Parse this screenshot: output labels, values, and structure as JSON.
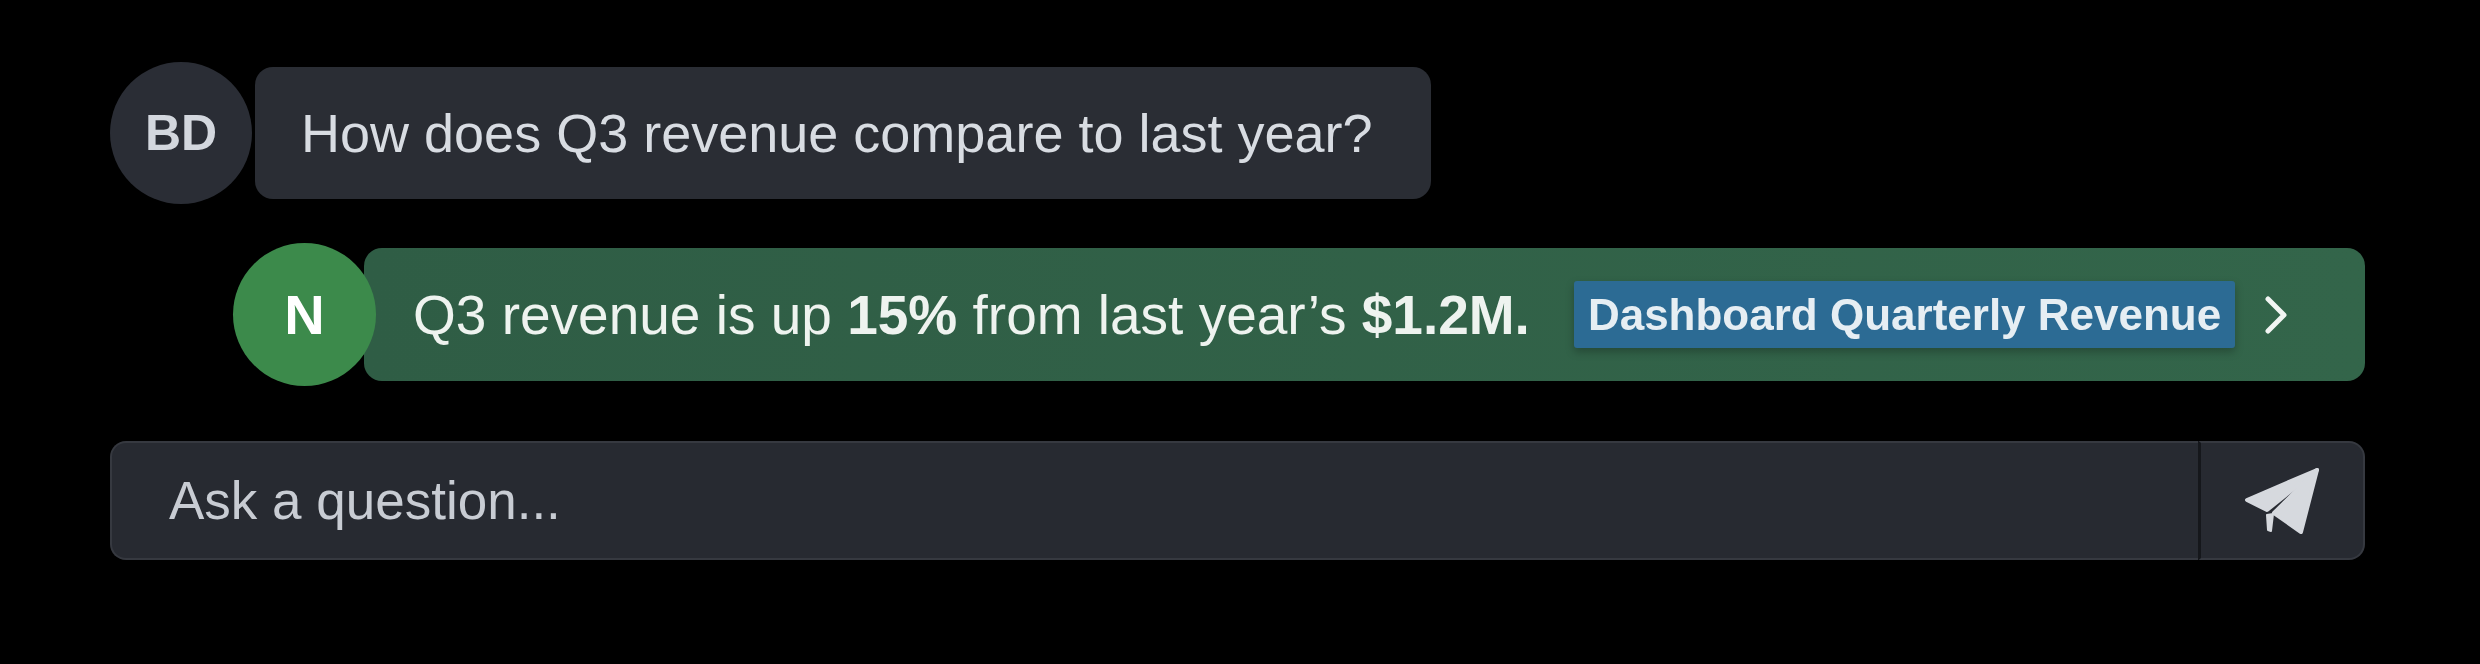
{
  "messages": [
    {
      "kind": "user",
      "avatar": "BD",
      "text": "How does Q3 revenue compare to last year?"
    },
    {
      "kind": "assistant",
      "avatar": "N",
      "text": "Q3 revenue is up **15%** from last year’s **$1.2M.**",
      "source": {
        "label": "Dashboard Quarterly Revenue"
      }
    }
  ],
  "composer": {
    "placeholder": "Ask a question..."
  }
}
